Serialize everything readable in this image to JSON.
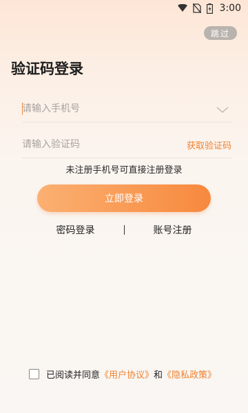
{
  "status_bar": {
    "time": "3:00",
    "icons": [
      "wifi-icon",
      "no-sim-icon",
      "battery-charging-icon"
    ]
  },
  "skip_label": "跳过",
  "title": "验证码登录",
  "phone": {
    "placeholder": "请输入手机号",
    "value": ""
  },
  "code": {
    "placeholder": "请输入验证码",
    "value": "",
    "get_code_label": "获取验证码"
  },
  "hint": "未注册手机号可直接注册登录",
  "login_label": "立即登录",
  "alt_links": {
    "password_login": "密码登录",
    "register": "账号注册"
  },
  "agreement": {
    "checked": false,
    "prefix": "已阅读并同意",
    "user_agreement": "《用户协议》",
    "and": "和",
    "privacy_policy": "《隐私政策》"
  },
  "colors": {
    "accent": "#ef8230",
    "button_gradient_start": "#fbb072",
    "button_gradient_end": "#f7893d"
  }
}
